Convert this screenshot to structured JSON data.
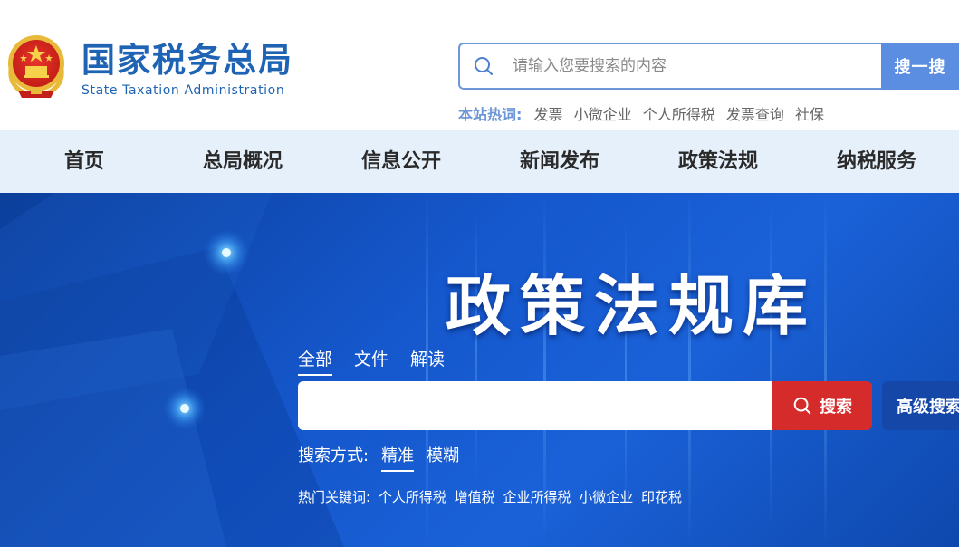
{
  "site": {
    "title_cn": "国家税务总局",
    "title_en": "State Taxation Administration"
  },
  "search": {
    "placeholder": "请输入您要搜索的内容",
    "button": "搜一搜",
    "hot_label": "本站热词:",
    "hot_words": [
      "发票",
      "小微企业",
      "个人所得税",
      "发票查询",
      "社保"
    ]
  },
  "nav": {
    "items": [
      "首页",
      "总局概况",
      "信息公开",
      "新闻发布",
      "政策法规",
      "纳税服务"
    ]
  },
  "hero": {
    "title": "政策法规库",
    "tabs": [
      "全部",
      "文件",
      "解读"
    ],
    "search_button": "搜索",
    "advanced_button": "高级搜索",
    "mode_label": "搜索方式:",
    "modes": [
      "精准",
      "模糊"
    ],
    "hot_label": "热门关键词:",
    "keywords": [
      "个人所得税",
      "增值税",
      "企业所得税",
      "小微企业",
      "印花税"
    ]
  },
  "colors": {
    "brand_blue": "#1e63b4",
    "search_button": "#5b8ee0",
    "nav_bg": "#e6f0fb",
    "hero_blue": "#1557cc",
    "search_red": "#d62b2b",
    "advanced_blue": "#1547a8"
  },
  "icons": [
    "national-emblem-icon",
    "search-icon"
  ]
}
